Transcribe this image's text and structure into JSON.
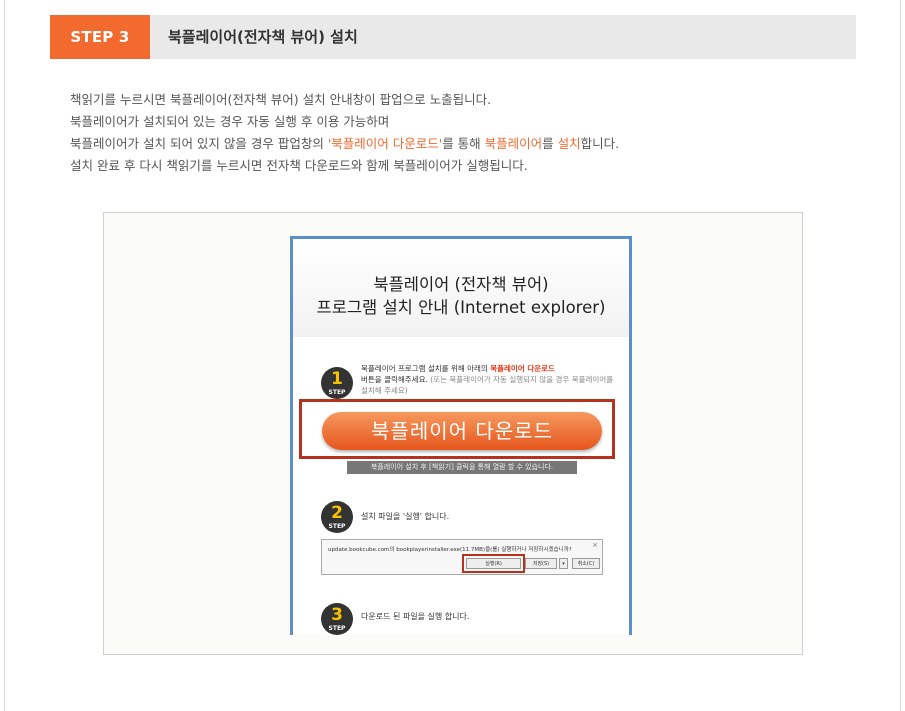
{
  "step": {
    "badge": "STEP 3",
    "title": "북플레이어(전자책 뷰어) 설치"
  },
  "description": {
    "line1": "책읽기를 누르시면 북플레이어(전자책 뷰어) 설치 안내창이 팝업으로 노출됩니다.",
    "line2": "북플레이어가 설치되어 있는 경우 자동 실행 후 이용 가능하며",
    "line3_a": "북플레이어가 설치 되어 있지 않을 경우 팝업창의 ",
    "line3_hl1": "'북플레이어 다운로드'",
    "line3_b": "를 통해 ",
    "line3_hl2": "북플레이어",
    "line3_c": "를 ",
    "line3_hl3": "설치",
    "line3_d": "합니다.",
    "line4": "설치 완료 후 다시 책읽기를 누르시면 전자책 다운로드와 함께 북플레이어가 실행됩니다."
  },
  "popup": {
    "title_line1": "북플레이어 (전자책 뷰어)",
    "title_line2": "프로그램 설치 안내 (Internet explorer)",
    "step_label": "STEP",
    "step1": {
      "num": "1",
      "text_a": "북플레이어 프로그램 설치를 위해 아래의 ",
      "text_hl": "북플레이어 다운로드",
      "text_b": "버튼을 클릭해주세요.",
      "note": "(또는 북플레이어가 자동 실행되지 않을 경우 북플레이어를 설치해 주세요)"
    },
    "download_button": "북플레이어 다운로드",
    "download_note": "북플레이어 설치 후 [책읽기] 클릭을 통해 열람 할 수 있습니다.",
    "step2": {
      "num": "2",
      "text": "설치 파일을 '실행' 합니다."
    },
    "download_bar": {
      "text": "update.bookcube.com의 bookplayerinstaller.exe(11.7MB)을(를) 실행하거나 저장하시겠습니까?",
      "close": "×",
      "run": "실행(R)",
      "save": "저장(S)",
      "arrow": "▾",
      "cancel": "취소(C)"
    },
    "step3": {
      "num": "3",
      "text": "다운로드 된 파일을 실행 합니다."
    }
  },
  "colors": {
    "accent": "#f26a2e",
    "highlight_border": "#b5321e",
    "popup_border": "#5b8fc9"
  }
}
